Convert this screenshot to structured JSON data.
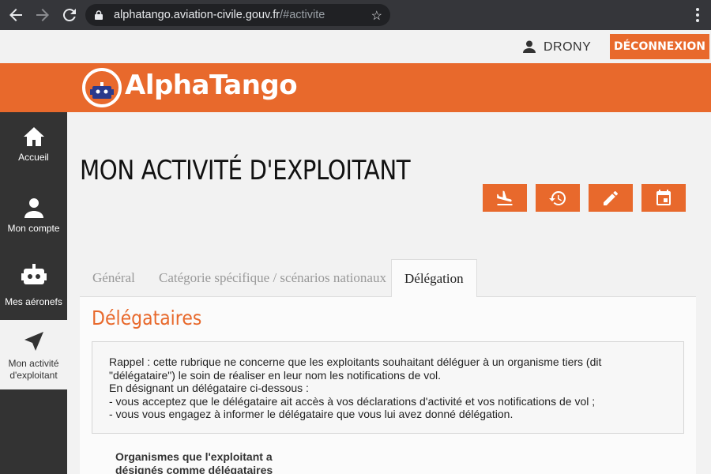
{
  "browser": {
    "url_domain": "alphatango.aviation-civile.gouv.fr",
    "url_path": "/#activite"
  },
  "user_bar": {
    "username": "DRONY",
    "logout_label": "DÉCONNEXION"
  },
  "header": {
    "logo_text": "AlphaTango"
  },
  "sidebar": {
    "items": [
      {
        "label": "Accueil",
        "icon": "home-icon"
      },
      {
        "label": "Mon compte",
        "icon": "person-icon"
      },
      {
        "label": "Mes aéronefs",
        "icon": "robot-icon"
      },
      {
        "label": "Mon activité d'exploitant",
        "icon": "navigation-arrow-icon"
      }
    ]
  },
  "main": {
    "title": "MON ACTIVITÉ D'EXPLOITANT",
    "action_icons": [
      "flight-land-icon",
      "history-icon",
      "edit-icon",
      "event-icon"
    ],
    "tabs": [
      {
        "label": "Général"
      },
      {
        "label": "Catégorie spécifique / scénarios nationaux"
      },
      {
        "label": "Délégation"
      }
    ],
    "section_title": "Délégataires",
    "info_lines": [
      "Rappel : cette rubrique ne concerne que les exploitants souhaitant déléguer à un organisme tiers (dit",
      "\"délégataire\") le soin de réaliser en leur nom les notifications de vol.",
      "En désignant un délégataire ci-dessous :",
      "- vous acceptez que le délégataire ait accès à vos déclarations d'activité et vos notifications de vol ;",
      "- vous vous engagez à informer le délégataire que vous lui avez donné délégation."
    ],
    "orgs_label_line1": "Organismes que l'exploitant a",
    "orgs_label_line2": "désignés comme délégataires"
  },
  "colors": {
    "accent": "#e8692c",
    "sidebar_bg": "#333333",
    "browser_bg": "#35363a"
  }
}
